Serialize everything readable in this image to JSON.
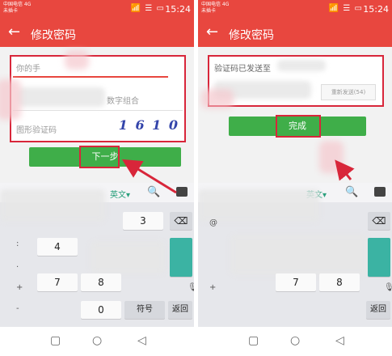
{
  "status": {
    "carrier_line1": "中国电信 4G",
    "carrier_line2": "未插卡",
    "icons": "📶 ☰ ▭",
    "time": "15:24"
  },
  "appbar": {
    "back": "←",
    "title": "修改密码"
  },
  "left": {
    "phone_placeholder": "你的手",
    "password_hint": "数字组合",
    "captcha_placeholder": "图形验证码",
    "captcha_text": "1 6 1 0",
    "next_button": "下一步"
  },
  "right": {
    "sent_label": "验证码已发送至",
    "resend_label": "重新发送(54)",
    "done_button": "完成"
  },
  "keyboard": {
    "lang": "英文",
    "lang_caret": "▾",
    "search": "🔍",
    "side_keys": [
      ":",
      ".",
      "+",
      "-"
    ],
    "keys": [
      "3",
      "4",
      "7",
      "8",
      "0",
      "符号",
      "返回"
    ],
    "delete": "⌫",
    "mic": "🎙"
  },
  "nav": {
    "back": "◁",
    "home": "○",
    "recent": "▢"
  }
}
